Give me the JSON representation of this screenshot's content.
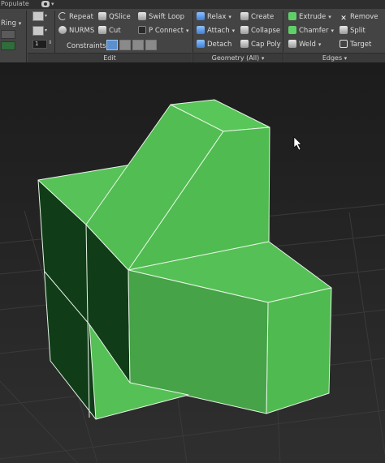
{
  "top_strip": {
    "label": "Populate"
  },
  "left_panel": {
    "ring_label": "Ring",
    "spinner_value": "1"
  },
  "edit_panel": {
    "title": "Edit",
    "buttons": {
      "repeat": "Repeat",
      "qslice": "QSlice",
      "swift_loop": "Swift Loop",
      "nurms": "NURMS",
      "cut": "Cut",
      "p_connect": "P Connect"
    },
    "constraints_label": "Constraints:"
  },
  "geometry_panel": {
    "title": "Geometry (All)",
    "buttons": {
      "relax": "Relax",
      "create": "Create",
      "attach": "Attach",
      "collapse": "Collapse",
      "detach": "Detach",
      "cap_poly": "Cap Poly"
    }
  },
  "edges_panel": {
    "title": "Edges",
    "buttons": {
      "extrude": "Extrude",
      "remove": "Remove",
      "chamfer": "Chamfer",
      "split": "Split",
      "weld": "Weld",
      "target": "Target"
    }
  },
  "colors": {
    "ribbon_bg": "#444444",
    "viewport_bg_top": "#1e1e1e",
    "viewport_bg_bottom": "#2d2d2d",
    "grid_line": "#3a3a3a",
    "mesh_green_light": "#56c257",
    "mesh_green_mid": "#49b04a",
    "mesh_green_dark": "#113d18",
    "edge_white": "#e8f5e8"
  }
}
